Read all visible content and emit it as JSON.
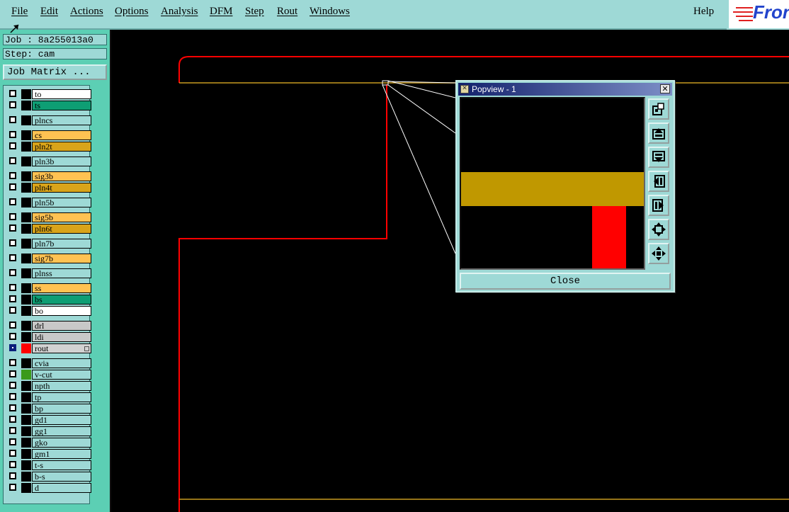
{
  "menubar": {
    "items": [
      "File",
      "Edit",
      "Actions",
      "Options",
      "Analysis",
      "DFM",
      "Step",
      "Rout",
      "Windows"
    ],
    "help": "Help"
  },
  "logo": {
    "text": "Fron"
  },
  "panel": {
    "job": "Job : 8a255013a0",
    "step": "Step: cam",
    "job_matrix": "Job Matrix ..."
  },
  "layers": [
    {
      "name": "to",
      "color": "#ffffff"
    },
    {
      "name": "ts",
      "color": "#0e9e74"
    },
    {
      "name": "plncs",
      "color": "#9ed9d6"
    },
    {
      "name": "cs",
      "color": "#ffc252"
    },
    {
      "name": "pln2t",
      "color": "#d9a41a"
    },
    {
      "name": "pln3b",
      "color": "#9ed9d6"
    },
    {
      "name": "sig3b",
      "color": "#ffc252"
    },
    {
      "name": "pln4t",
      "color": "#d9a41a"
    },
    {
      "name": "pln5b",
      "color": "#9ed9d6"
    },
    {
      "name": "sig5b",
      "color": "#ffc252"
    },
    {
      "name": "pln6t",
      "color": "#d9a41a"
    },
    {
      "name": "pln7b",
      "color": "#9ed9d6"
    },
    {
      "name": "sig7b",
      "color": "#ffc252"
    },
    {
      "name": "plnss",
      "color": "#9ed9d6"
    },
    {
      "name": "ss",
      "color": "#ffc252"
    },
    {
      "name": "bs",
      "color": "#0e9e74"
    },
    {
      "name": "bo",
      "color": "#ffffff"
    },
    {
      "name": "drl",
      "color": "#c8c8c8"
    },
    {
      "name": "ldi",
      "color": "#c8c8c8"
    },
    {
      "name": "rout",
      "color": "#d2d2d2",
      "active": true,
      "swatch": "#ff0000"
    },
    {
      "name": "cvia",
      "color": "#9ed9d6"
    },
    {
      "name": "v-cut",
      "color": "#9ed9d6",
      "swatch": "#3a9a1a"
    },
    {
      "name": "npth",
      "color": "#9ed9d6"
    },
    {
      "name": "tp",
      "color": "#9ed9d6"
    },
    {
      "name": "bp",
      "color": "#9ed9d6"
    },
    {
      "name": "gd1",
      "color": "#9ed9d6"
    },
    {
      "name": "gg1",
      "color": "#9ed9d6"
    },
    {
      "name": "gko",
      "color": "#9ed9d6"
    },
    {
      "name": "gm1",
      "color": "#9ed9d6"
    },
    {
      "name": "t-s",
      "color": "#9ed9d6"
    },
    {
      "name": "b-s",
      "color": "#9ed9d6"
    },
    {
      "name": "d",
      "color": "#9ed9d6"
    }
  ],
  "popview": {
    "title": "Popview - 1",
    "close_label": "Close",
    "tools": [
      "zoom-icon",
      "move-up-icon",
      "move-down-icon",
      "move-left-icon",
      "move-right-icon",
      "zoom-fit-icon",
      "pan-icon"
    ]
  },
  "colors": {
    "panel_bg": "#9ed9d6",
    "rout_line": "#ff0000",
    "board_outline": "#c89a20",
    "leader_line": "#ffffff"
  }
}
